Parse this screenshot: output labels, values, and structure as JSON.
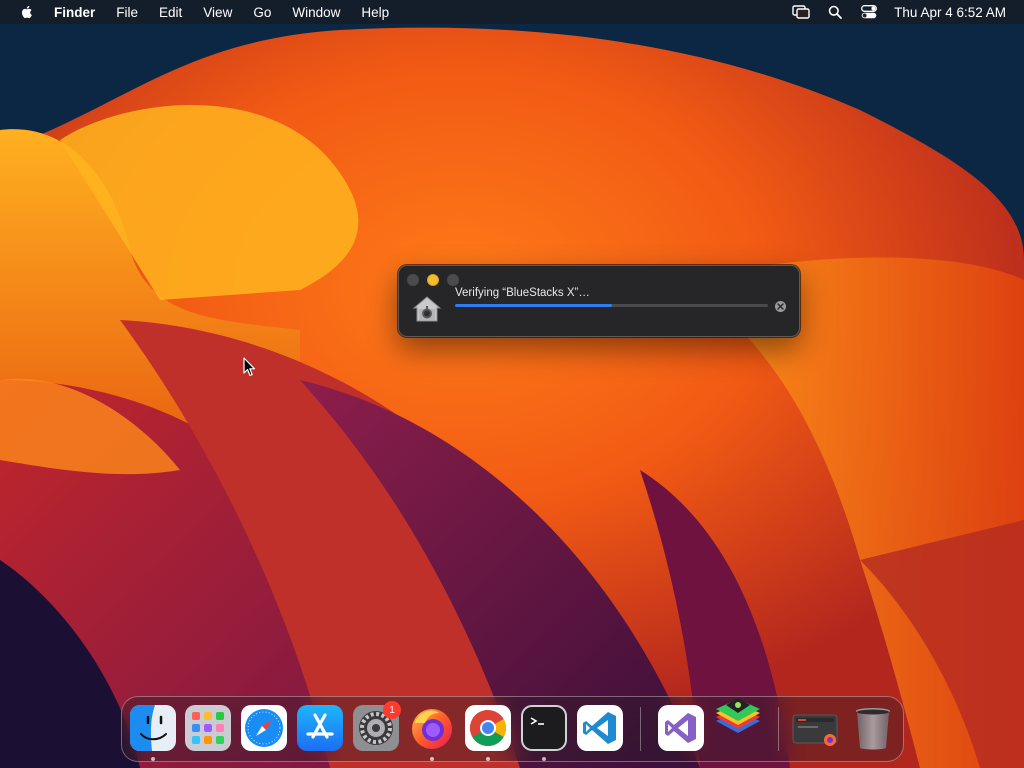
{
  "menubar": {
    "app_name": "Finder",
    "items": [
      "File",
      "Edit",
      "View",
      "Go",
      "Window",
      "Help"
    ],
    "clock": "Thu Apr 4  6:52 AM",
    "status_icons": [
      "screen-mirroring-icon",
      "spotlight-search-icon",
      "control-center-icon"
    ]
  },
  "dialog": {
    "message": "Verifying “BlueStacks X”…",
    "progress": 0.5,
    "icon": "gatekeeper-house-icon",
    "traffic_lights": [
      "close",
      "minimize",
      "zoom"
    ]
  },
  "dock": {
    "apps": [
      {
        "name": "Finder",
        "icon": "finder-icon",
        "running": true
      },
      {
        "name": "Launchpad",
        "icon": "launchpad-icon",
        "running": false
      },
      {
        "name": "Safari",
        "icon": "safari-icon",
        "running": false
      },
      {
        "name": "App Store",
        "icon": "app-store-icon",
        "running": false
      },
      {
        "name": "System Settings",
        "icon": "system-settings-icon",
        "running": false,
        "badge": "1"
      },
      {
        "name": "Firefox",
        "icon": "firefox-icon",
        "running": true
      },
      {
        "name": "Chrome",
        "icon": "chrome-icon",
        "running": true
      },
      {
        "name": "Terminal",
        "icon": "terminal-icon",
        "running": true
      },
      {
        "name": "Visual Studio Code",
        "icon": "vscode-icon",
        "running": false
      },
      {
        "name": "Visual Studio",
        "icon": "visual-studio-icon",
        "running": false
      },
      {
        "name": "BlueStacks",
        "icon": "bluestacks-icon",
        "running": false
      },
      {
        "name": "Downloads",
        "icon": "downloads-stack-icon",
        "running": false
      },
      {
        "name": "Trash",
        "icon": "trash-icon",
        "running": false
      }
    ]
  },
  "colors": {
    "accent": "#2f7bf0",
    "badge": "#ff3b30",
    "dialog_bg": "#262628"
  }
}
